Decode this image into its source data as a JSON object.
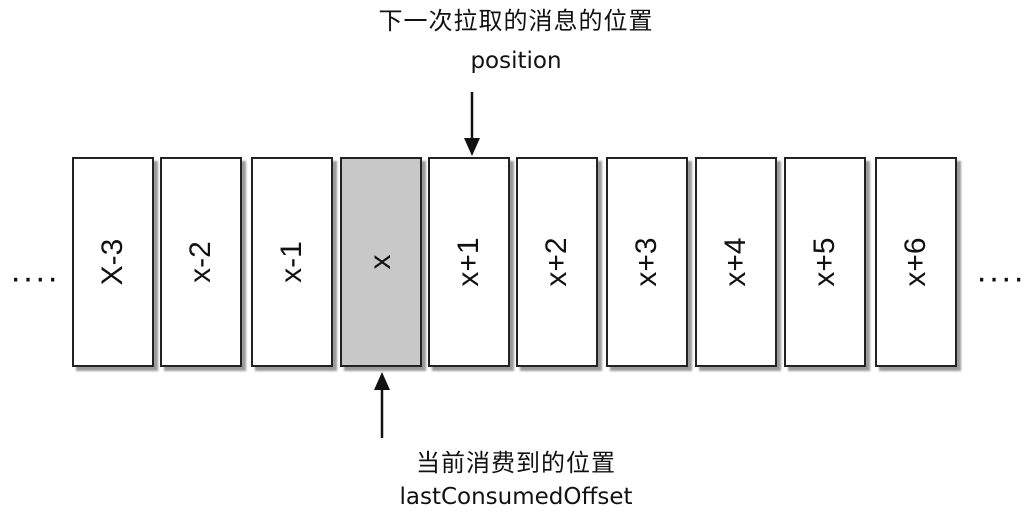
{
  "top_label": {
    "title": "下一次拉取的消息的位置",
    "subtitle": "position"
  },
  "bottom_label": {
    "title": "当前消费到的位置",
    "subtitle": "lastConsumedOffset"
  },
  "ellipsis": {
    "left": "····",
    "right": "····"
  },
  "cells": [
    {
      "label": "X-3",
      "highlighted": false
    },
    {
      "label": "x-2",
      "highlighted": false
    },
    {
      "label": "x-1",
      "highlighted": false
    },
    {
      "label": "x",
      "highlighted": true
    },
    {
      "label": "x+1",
      "highlighted": false
    },
    {
      "label": "x+2",
      "highlighted": false
    },
    {
      "label": "x+3",
      "highlighted": false
    },
    {
      "label": "x+4",
      "highlighted": false
    },
    {
      "label": "x+5",
      "highlighted": false
    },
    {
      "label": "x+6",
      "highlighted": false
    }
  ],
  "colors": {
    "highlight": "#c8c8c8",
    "cell": "#ffffff",
    "border": "#222222"
  }
}
